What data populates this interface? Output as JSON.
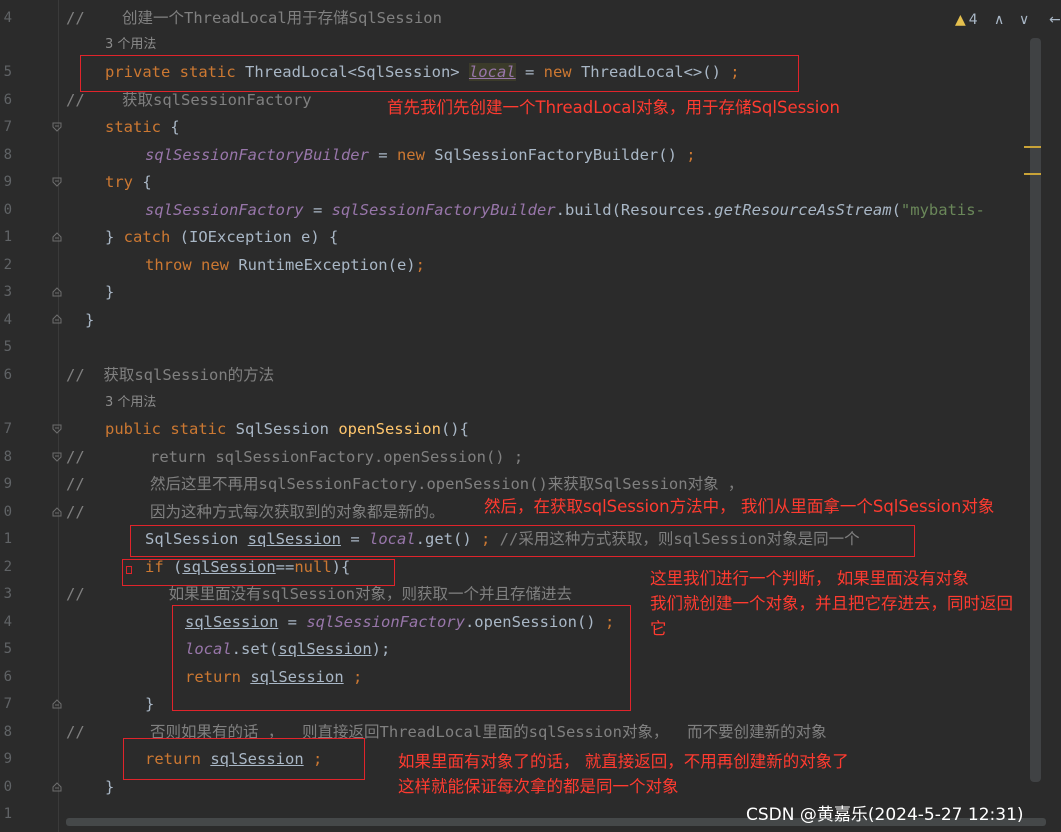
{
  "line_numbers": [
    "4",
    "5",
    "6",
    "7",
    "8",
    "9",
    "0",
    "1",
    "2",
    "3",
    "4",
    "5",
    "6",
    "7",
    "8",
    "9",
    "0",
    "1",
    "2",
    "3",
    "4",
    "5",
    "6",
    "7",
    "8",
    "9",
    "0",
    "1"
  ],
  "hints": [
    "3 个用法",
    "3 个用法"
  ],
  "lines": {
    "l4": [
      "//",
      "    创建一个ThreadLocal用于存储SqlSession"
    ],
    "l5": [
      "private static ",
      "ThreadLocal<SqlSession> ",
      "local",
      " = ",
      "new ",
      "ThreadLocal<>() ",
      ";"
    ],
    "l6": [
      "//",
      "    获取sqlSessionFactory"
    ],
    "l7": [
      "static ",
      "{"
    ],
    "l8": [
      "sqlSessionFactoryBuilder",
      " = ",
      "new ",
      "SqlSessionFactoryBuilder() ",
      ";"
    ],
    "l9": [
      "try ",
      "{"
    ],
    "l10": [
      "sqlSessionFactory",
      " = ",
      "sqlSessionFactoryBuilder",
      ".build(Resources.",
      "getResourceAsStream",
      "(",
      "\"mybatis-"
    ],
    "l11": [
      "} ",
      "catch ",
      "(IOException e) {"
    ],
    "l12": [
      "throw new ",
      "RuntimeException(e)",
      ";"
    ],
    "l13": [
      "}"
    ],
    "l14": [
      "}"
    ],
    "l16": [
      "//",
      "  获取sqlSession的方法"
    ],
    "l17": [
      "public static ",
      "SqlSession ",
      "openSession",
      "(){"
    ],
    "l18": [
      "//",
      "       return sqlSessionFactory.openSession() ;"
    ],
    "l19": [
      "//",
      "       然后这里不再用sqlSessionFactory.openSession()来获取SqlSession对象 ，"
    ],
    "l20": [
      "//",
      "       因为这种方式每次获取到的对象都是新的。"
    ],
    "l21": [
      "SqlSession ",
      "sqlSession",
      " = ",
      "local",
      ".get() ",
      "; ",
      "//采用这种方式获取，则sqlSession对象是同一个"
    ],
    "l22": [
      "if ",
      "(",
      "sqlSession",
      "==",
      "null",
      "){"
    ],
    "l23": [
      "//",
      "         如果里面没有sqlSession对象，则获取一个并且存储进去"
    ],
    "l24": [
      "sqlSession",
      " = ",
      "sqlSessionFactory",
      ".openSession() ",
      ";"
    ],
    "l25": [
      "local",
      ".set(",
      "sqlSession",
      ");"
    ],
    "l26": [
      "return ",
      "sqlSession",
      " ;"
    ],
    "l27": [
      "}"
    ],
    "l28": [
      "//",
      "       否则如果有的话 ，  则直接返回ThreadLocal里面的sqlSession对象，  而不要创建新的对象"
    ],
    "l29": [
      "return ",
      "sqlSession",
      " ;"
    ],
    "l30": [
      "}"
    ]
  },
  "annotations": {
    "a1": "首先我们先创建一个ThreadLocal对象，用于存储SqlSession",
    "a2": "然后，在获取sqlSession方法中， 我们从里面拿一个SqlSession对象",
    "a3_1": "这里我们进行一个判断， 如果里面没有对象",
    "a3_2": "我们就创建一个对象，并且把它存进去，同时返回",
    "a3_3": "它",
    "a4_1": "如果里面有对象了的话， 就直接返回，不用再创建新的对象了",
    "a4_2": "这样就能保证每次拿的都是同一个对象"
  },
  "toolbar": {
    "warning_count": "4",
    "up_icon": "∧",
    "down_icon": "∨",
    "arrow_icon": "←"
  },
  "watermark": "CSDN @黄嘉乐(2024-5-27 12:31)",
  "colors": {
    "annotation": "#ff3b30",
    "keyword": "#cc7832",
    "field": "#9876aa",
    "method": "#ffc66d",
    "comment": "#808080"
  }
}
